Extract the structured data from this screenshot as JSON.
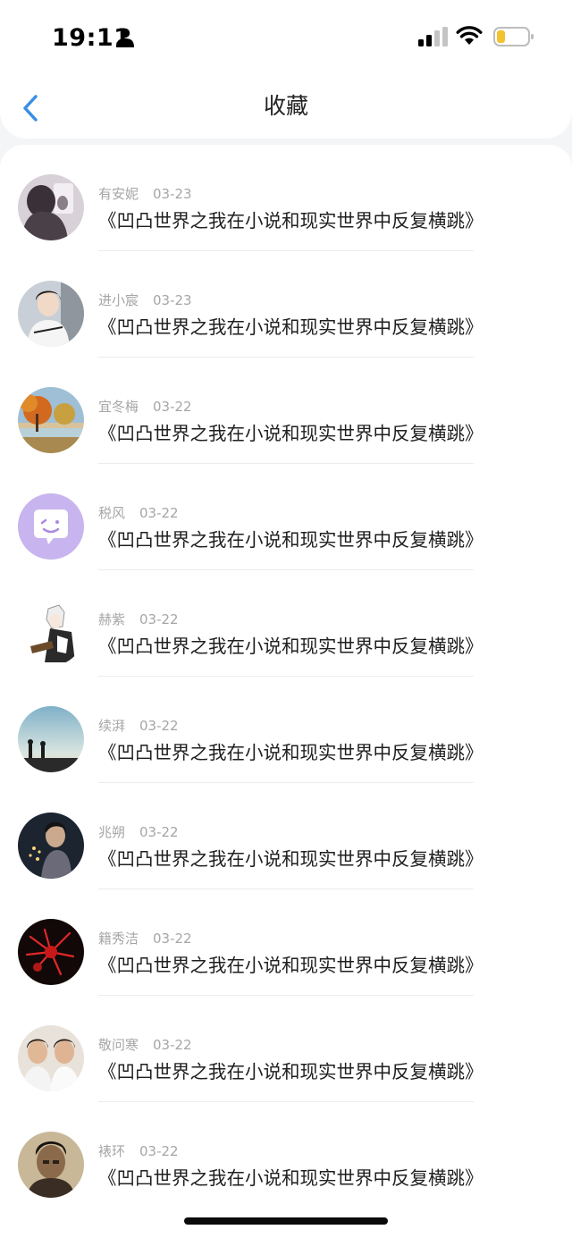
{
  "status_bar": {
    "time": "19:11"
  },
  "nav": {
    "title": "收藏"
  },
  "items": [
    {
      "name": "有安妮",
      "date": "03-23",
      "text": "《凹凸世界之我在小说和现实世界中反复横跳》",
      "avatar": "avatar-girl-selfie"
    },
    {
      "name": "进小宸",
      "date": "03-23",
      "text": "《凹凸世界之我在小说和现实世界中反复横跳》",
      "avatar": "avatar-girl-photo"
    },
    {
      "name": "宜冬梅",
      "date": "03-22",
      "text": "《凹凸世界之我在小说和现实世界中反复横跳》",
      "avatar": "avatar-autumn-landscape"
    },
    {
      "name": "税风",
      "date": "03-22",
      "text": "《凹凸世界之我在小说和现实世界中反复横跳》",
      "avatar": "avatar-chat-emoji"
    },
    {
      "name": "赫紫",
      "date": "03-22",
      "text": "《凹凸世界之我在小说和现实世界中反复横跳》",
      "avatar": "avatar-anime-character"
    },
    {
      "name": "续湃",
      "date": "03-22",
      "text": "《凹凸世界之我在小说和现实世界中反复横跳》",
      "avatar": "avatar-silhouette-couple"
    },
    {
      "name": "兆朔",
      "date": "03-22",
      "text": "《凹凸世界之我在小说和现实世界中反复横跳》",
      "avatar": "avatar-girl-lights"
    },
    {
      "name": "籍秀洁",
      "date": "03-22",
      "text": "《凹凸世界之我在小说和现实世界中反复横跳》",
      "avatar": "avatar-red-flower"
    },
    {
      "name": "敬问寒",
      "date": "03-22",
      "text": "《凹凸世界之我在小说和现实世界中反复横跳》",
      "avatar": "avatar-two-boys"
    },
    {
      "name": "裱环",
      "date": "03-22",
      "text": "《凹凸世界之我在小说和现实世界中反复横跳》",
      "avatar": "avatar-man-portrait"
    }
  ],
  "colors": {
    "accent": "#3a8ee6",
    "text_primary": "#1f1f1f",
    "text_secondary": "#a6a6a6",
    "battery_level": "#f2c230"
  }
}
